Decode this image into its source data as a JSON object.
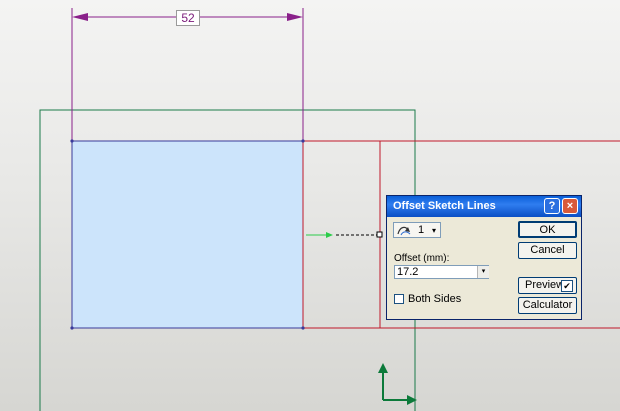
{
  "sketch": {
    "dimension_value": "52",
    "colors": {
      "dimension": "#8a208a",
      "rect_fill": "#cce4fb",
      "rect_stroke": "#3a3a9a",
      "offset_line": "#c0182a",
      "outline": "#1a7a4a",
      "preview_arrow": "#2ccc4a",
      "triad": "#0c7a3a"
    }
  },
  "dialog": {
    "title": "Offset Sketch Lines",
    "help_label": "?",
    "close_label": "×",
    "count_value": "1",
    "count_arrow": "▾",
    "offset_label": "Offset (mm):",
    "offset_value": "17.2",
    "offset_drop": "▾",
    "both_sides_label": "Both Sides",
    "both_sides_checked": false,
    "ok_label": "OK",
    "cancel_label": "Cancel",
    "preview_label": "Preview",
    "preview_checked": "✔",
    "calculator_label": "Calculator",
    "icons": [
      "flip-direction-icon"
    ]
  }
}
